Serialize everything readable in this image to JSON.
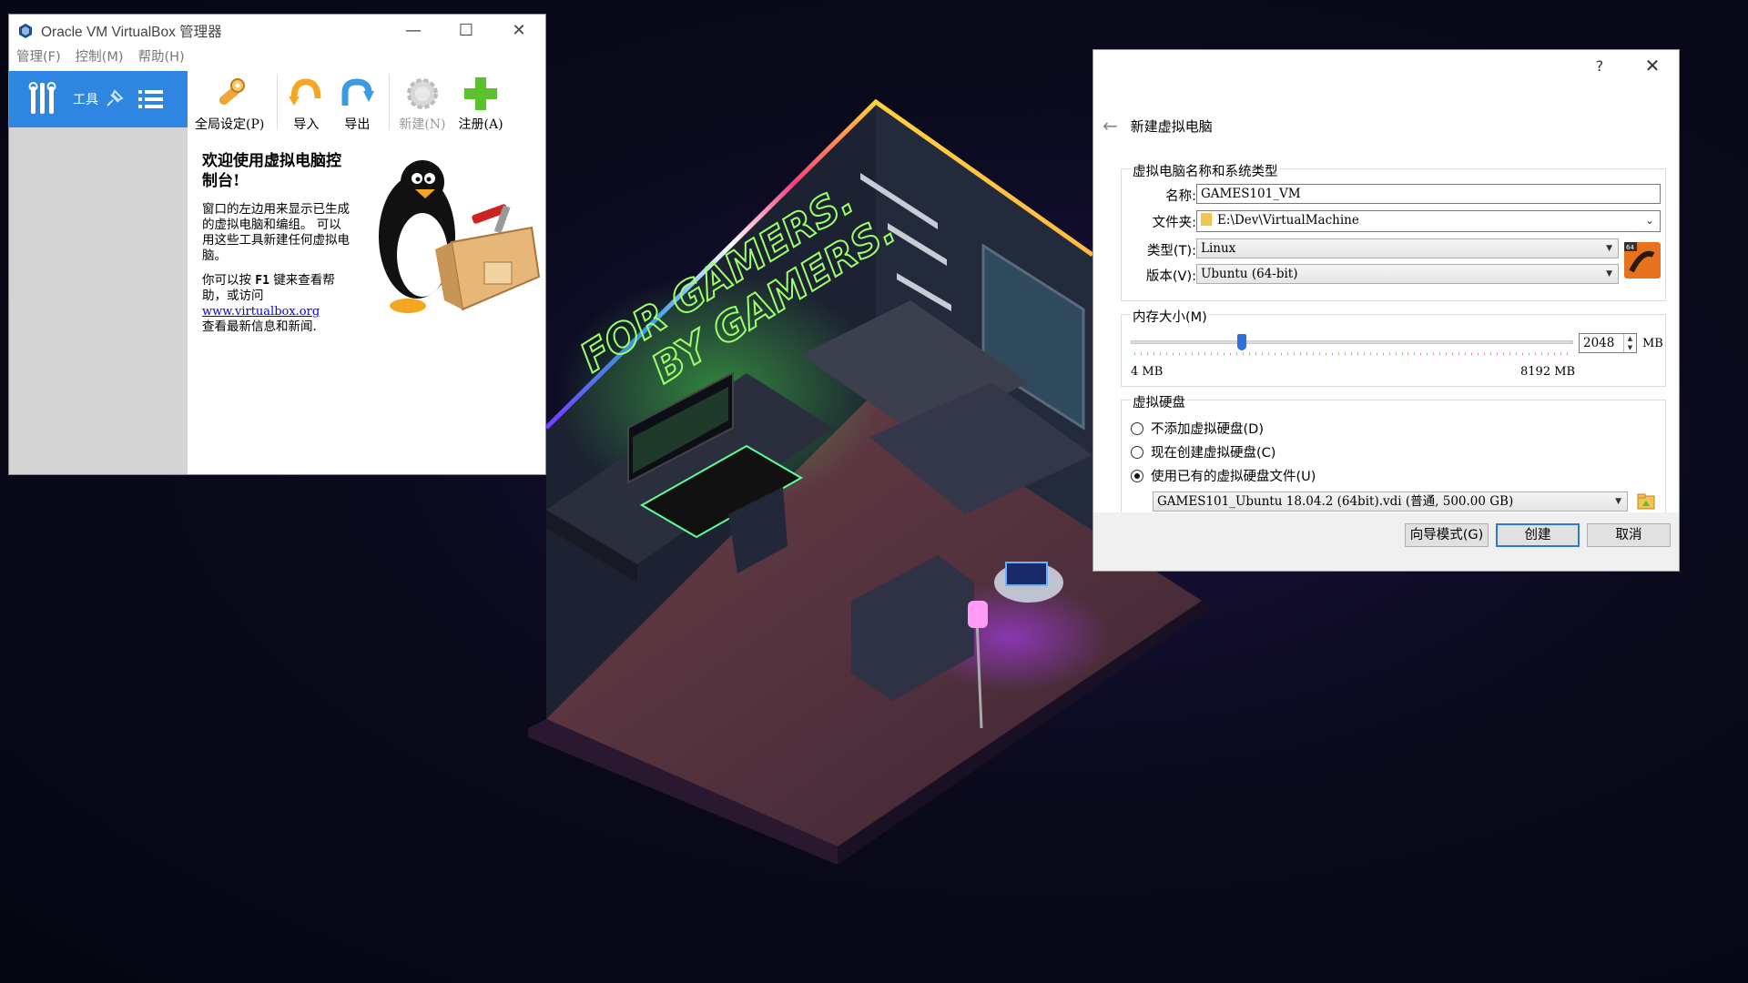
{
  "manager": {
    "title": "Oracle VM VirtualBox 管理器",
    "menu": [
      "管理(F)",
      "控制(M)",
      "帮助(H)"
    ],
    "tools_label": "工具",
    "toolbar": {
      "prefs": "全局设定(P)",
      "import": "导入",
      "export": "导出",
      "new": "新建(N)",
      "register": "注册(A)"
    },
    "welcome": {
      "heading": "欢迎使用虚拟电脑控制台!",
      "para1": "窗口的左边用来显示已生成的虚拟电脑和编组。 可以用这些工具新建任何虚拟电脑。",
      "para2_a": "你可以按",
      "para2_key": "F1",
      "para2_b": "键来查看帮助，或访问",
      "link": "www.virtualbox.org",
      "para2_c": "查看最新信息和新闻."
    }
  },
  "dialog": {
    "help_btn": "?",
    "title": "新建虚拟电脑",
    "name_group": {
      "title": "虚拟电脑名称和系统类型",
      "name_label": "名称:",
      "name_value": "GAMES101_VM",
      "folder_label": "文件夹:",
      "folder_value": "E:\\Dev\\VirtualMachine",
      "type_label": "类型(T):",
      "type_value": "Linux",
      "version_label": "版本(V):",
      "version_value": "Ubuntu (64-bit)"
    },
    "memory_group": {
      "title": "内存大小(M)",
      "value": "2048",
      "unit": "MB",
      "min_label": "4 MB",
      "max_label": "8192 MB",
      "level_fraction": 0.25
    },
    "disk_group": {
      "title": "虚拟硬盘",
      "options": [
        "不添加虚拟硬盘(D)",
        "现在创建虚拟硬盘(C)",
        "使用已有的虚拟硬盘文件(U)"
      ],
      "selected_index": 2,
      "file_value": "GAMES101_Ubuntu 18.04.2 (64bit).vdi (普通, 500.00 GB)"
    },
    "buttons": {
      "guided": "向导模式(G)",
      "create": "创建",
      "cancel": "取消"
    }
  },
  "wallpaper": {
    "neon_line1": "FOR GAMERS.",
    "neon_line2": "BY GAMERS."
  },
  "colors": {
    "accent_blue": "#2f86e0",
    "neon_green": "#7dff4f",
    "wall_dark": "#1d2230",
    "floor_wood": "#5a3a2e"
  }
}
